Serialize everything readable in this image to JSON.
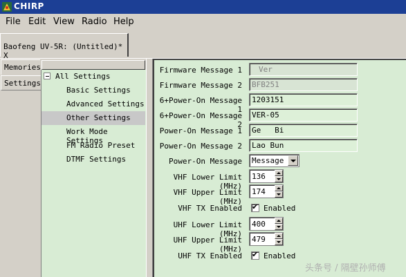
{
  "window": {
    "title": "CHIRP"
  },
  "menu": [
    "File",
    "Edit",
    "View",
    "Radio",
    "Help"
  ],
  "doc_tab": {
    "label": "Baofeng UV-5R: (Untitled)* X"
  },
  "side_tabs": {
    "memories": "Memories",
    "settings": "Settings"
  },
  "tree": {
    "root": "All Settings",
    "items": [
      "Basic Settings",
      "Advanced Settings",
      "Other Settings",
      "Work Mode Settings",
      "FM Radio Preset",
      "DTMF Settings"
    ],
    "selected": "Other Settings"
  },
  "settings": {
    "firmware_message_1": {
      "label": "Firmware Message 1",
      "value": "Ver"
    },
    "firmware_message_2": {
      "label": "Firmware Message 2",
      "value": "BFB251"
    },
    "power_on_6_1": {
      "label": "6+Power-On Message 1",
      "value": "1203151"
    },
    "power_on_6_2": {
      "label": "6+Power-On Message 2",
      "value": "VER-05"
    },
    "power_on_1": {
      "label": "Power-On Message 1",
      "value": "Ge   Bi"
    },
    "power_on_2": {
      "label": "Power-On Message 2",
      "value": "Lao Bun"
    },
    "power_on_message": {
      "label": "Power-On Message",
      "value": "Message"
    },
    "vhf_lower": {
      "label": "VHF Lower Limit (MHz)",
      "value": "136"
    },
    "vhf_upper": {
      "label": "VHF Upper Limit (MHz)",
      "value": "174"
    },
    "vhf_tx": {
      "label": "VHF TX Enabled",
      "check_label": "Enabled"
    },
    "uhf_lower": {
      "label": "UHF Lower Limit (MHz)",
      "value": "400"
    },
    "uhf_upper": {
      "label": "UHF Upper Limit (MHz)",
      "value": "479"
    },
    "uhf_tx": {
      "label": "UHF TX Enabled",
      "check_label": "Enabled"
    }
  },
  "watermark": "头条号 / 隔壁孙师傅",
  "colors": {
    "titlebar": "#1c3f95",
    "panel_green": "#d8ecd4"
  }
}
